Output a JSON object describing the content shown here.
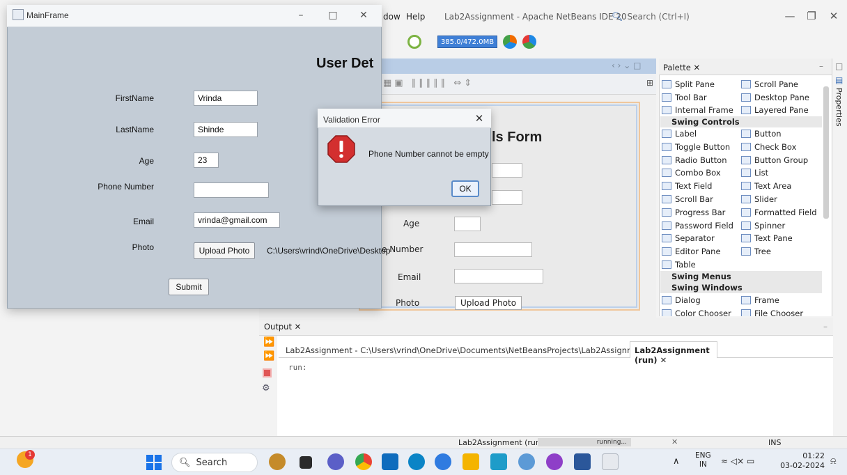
{
  "netbeans": {
    "menu": {
      "window_partial": "dow",
      "help": "Help"
    },
    "title": "Lab2Assignment - Apache NetBeans IDE 20",
    "search_placeholder": "Search (Ctrl+I)",
    "memory": "385.0/472.0MB",
    "design_form": {
      "title_partial": "ls Form",
      "labels": {
        "age": "Age",
        "phone_partial": "e Number",
        "email": "Email",
        "photo": "Photo"
      },
      "upload_button": "Upload Photo"
    },
    "palette": {
      "tab": "Palette",
      "items_top": [
        {
          "left": "Split Pane",
          "right": "Scroll Pane"
        },
        {
          "left": "Tool Bar",
          "right": "Desktop Pane"
        },
        {
          "left": "Internal Frame",
          "right": "Layered Pane"
        }
      ],
      "swing_controls": "Swing Controls",
      "controls": [
        {
          "left": "Label",
          "right": "Button"
        },
        {
          "left": "Toggle Button",
          "right": "Check Box"
        },
        {
          "left": "Radio Button",
          "right": "Button Group"
        },
        {
          "left": "Combo Box",
          "right": "List"
        },
        {
          "left": "Text Field",
          "right": "Text Area"
        },
        {
          "left": "Scroll Bar",
          "right": "Slider"
        },
        {
          "left": "Progress Bar",
          "right": "Formatted Field"
        },
        {
          "left": "Password Field",
          "right": "Spinner"
        },
        {
          "left": "Separator",
          "right": "Text Pane"
        },
        {
          "left": "Editor Pane",
          "right": "Tree"
        },
        {
          "left": "Table",
          "right": ""
        }
      ],
      "swing_menus": "Swing Menus",
      "swing_windows": "Swing Windows",
      "windows": [
        {
          "left": "Dialog",
          "right": "Frame"
        },
        {
          "left": "Color Chooser",
          "right": "File Chooser"
        }
      ]
    },
    "properties_tab": "Properties",
    "output": {
      "tab": "Output",
      "subtab_path": "Lab2Assignment - C:\\Users\\vrind\\OneDrive\\Documents\\NetBeansProjects\\Lab2Assignment",
      "subtab_run": "Lab2Assignment (run)",
      "console": "run:"
    },
    "status": {
      "task": "Lab2Assignment (run)",
      "progress": "running...",
      "mode": "INS"
    }
  },
  "mainframe": {
    "title": "MainFrame",
    "heading_partial": "User Det",
    "labels": {
      "firstname": "FirstName",
      "lastname": "LastName",
      "age": "Age",
      "phone": "Phone Number",
      "email": "Email",
      "photo": "Photo"
    },
    "values": {
      "firstname": "Vrinda",
      "lastname": "Shinde",
      "age": "23",
      "phone": "",
      "email": "vrinda@gmail.com"
    },
    "upload_button": "Upload Photo",
    "photo_path": "C:\\Users\\vrind\\OneDrive\\Desktop",
    "submit_button": "Submit"
  },
  "dialog": {
    "title": "Validation Error",
    "message": "Phone Number cannot be empty",
    "ok_button": "OK"
  },
  "taskbar": {
    "search_label": "Search",
    "language": "ENG",
    "region": "IN",
    "time": "01:22",
    "date": "03-02-2024",
    "notification_count": "1"
  }
}
